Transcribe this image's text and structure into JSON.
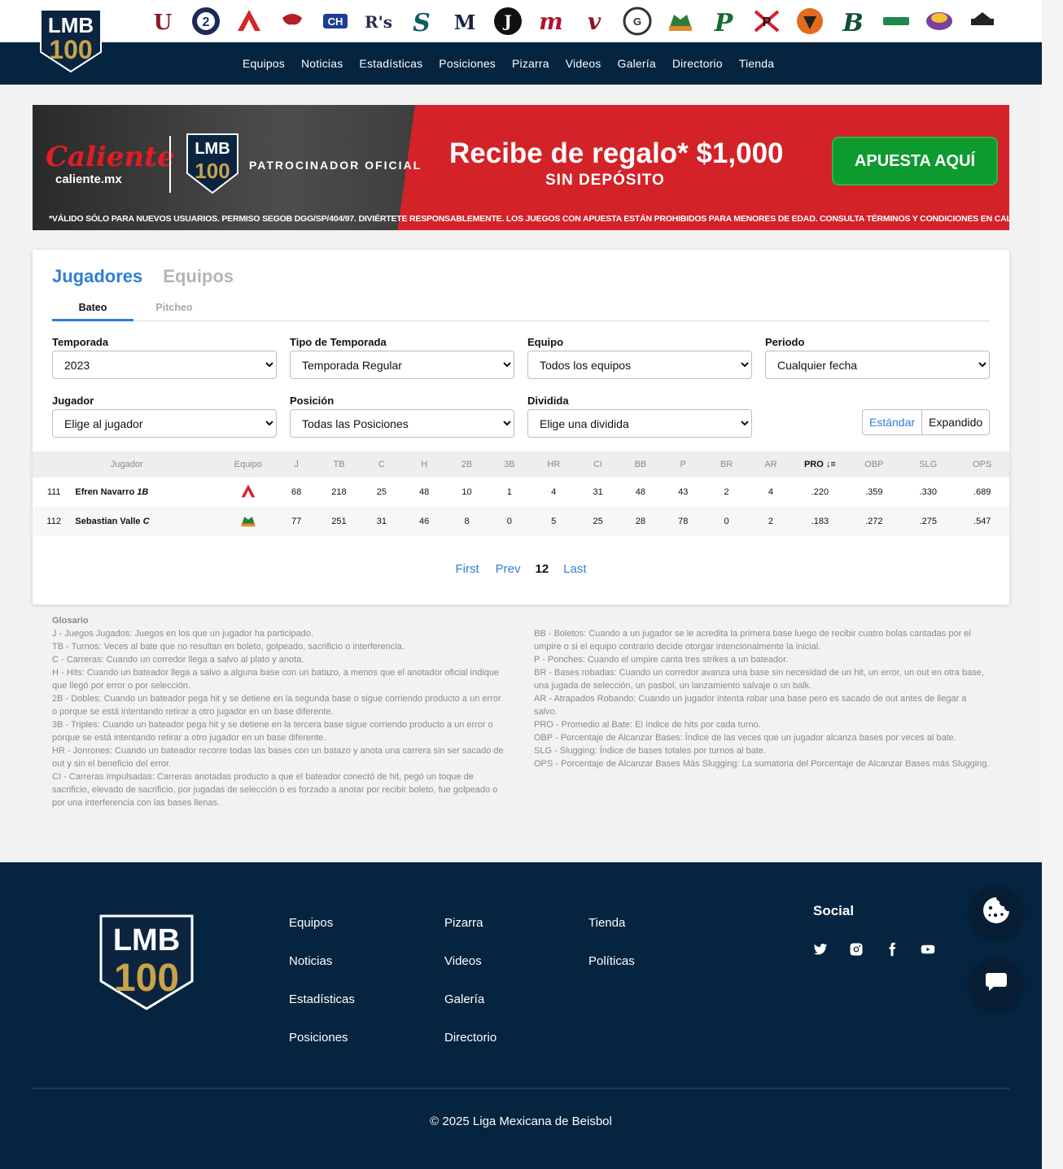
{
  "header": {
    "logo_alt": "LMB 100",
    "teams": [
      {
        "name": "Algodoneros de Unión Laguna",
        "icon": "ul-logo",
        "color": "#8b1a2b"
      },
      {
        "name": "Dos Laredos",
        "icon": "tecolotes-logo",
        "color": "#1d2a57"
      },
      {
        "name": "Acereros de Monclova",
        "icon": "acereros-logo",
        "color": "#d5262c"
      },
      {
        "name": "Toros de Tijuana",
        "icon": "toros-logo",
        "color": "#b12028"
      },
      {
        "name": "Rieleros de Aguascalientes",
        "icon": "rieleros-logo",
        "color": "#1c3f92"
      },
      {
        "name": "Saraperos de Saltillo",
        "icon": "saraperos-logo",
        "color": "#222a4e"
      },
      {
        "name": "Sultanes de Monterrey",
        "icon": "sultanes-logo",
        "color": "#0f5b63"
      },
      {
        "name": "Diablos Rojos del México",
        "icon": "diablos-logo",
        "color": "#1b2344"
      },
      {
        "name": "Generales de Durango",
        "icon": "generales-logo",
        "color": "#111111"
      },
      {
        "name": "Mariachis de Guadalajara",
        "icon": "mariachis-logo",
        "color": "#b3112e"
      },
      {
        "name": "Olmecas de Tabasco",
        "icon": "olmecas-logo",
        "color": "#8c1020"
      },
      {
        "name": "Guerreros de Oaxaca",
        "icon": "guerreros-logo",
        "color": "#333333"
      },
      {
        "name": "Leones de Yucatán",
        "icon": "leones-logo",
        "color": "#2f7a3a"
      },
      {
        "name": "Pericos de Puebla",
        "icon": "pericos-logo",
        "color": "#146b35"
      },
      {
        "name": "Piratas de Campeche",
        "icon": "piratas-logo",
        "color": "#d81d2a"
      },
      {
        "name": "Tigres de Quintana Roo",
        "icon": "tigres-logo",
        "color": "#e36b1c"
      },
      {
        "name": "Bravos de León",
        "icon": "bravos-logo",
        "color": "#0f5132"
      },
      {
        "name": "Conspiradores de Querétaro",
        "icon": "queretaro-logo",
        "color": "#1d8a4a"
      },
      {
        "name": "El Águila de Veracruz",
        "icon": "aguila-logo",
        "color": "#7b3fa0"
      },
      {
        "name": "Caliente de Durango",
        "icon": "durango-logo",
        "color": "#222222"
      }
    ],
    "nav": [
      "Equipos",
      "Noticias",
      "Estadísticas",
      "Posiciones",
      "Pizarra",
      "Videos",
      "Galería",
      "Directorio",
      "Tienda"
    ]
  },
  "banner": {
    "brand": "Caliente",
    "site": "caliente.mx",
    "lmb_label": "LMB",
    "sponsor": "PATROCINADOR OFICIAL",
    "promo_line1": "Recibe de regalo* $1,000",
    "promo_line2": "SIN DEPÓSITO",
    "cta": "APUESTA AQUÍ",
    "legal": "*VÁLIDO SÓLO PARA NUEVOS USUARIOS. PERMISO SEGOB DGG/SP/404/97. DIVIÉRTETE RESPONSABLEMENTE. LOS JUEGOS CON APUESTA ESTÁN PROHIBIDOS PARA MENORES DE EDAD. CONSULTA TÉRMINOS Y CONDICIONES EN CALIENTE.MX"
  },
  "stats": {
    "main_tabs": [
      "Jugadores",
      "Equipos"
    ],
    "sub_tabs": [
      "Bateo",
      "Pitcheo"
    ],
    "filters": {
      "temporada": {
        "label": "Temporada",
        "value": "2023"
      },
      "tipo": {
        "label": "Tipo de Temporada",
        "value": "Temporada Regular"
      },
      "equipo": {
        "label": "Equipo",
        "value": "Todos los equipos"
      },
      "periodo": {
        "label": "Periodo",
        "value": "Cualquier fecha"
      },
      "jugador": {
        "label": "Jugador",
        "value": "Elige al jugador"
      },
      "posicion": {
        "label": "Posición",
        "value": "Todas las Posiciones"
      },
      "dividida": {
        "label": "Dividida",
        "value": "Elige una dividida"
      }
    },
    "view": {
      "standard": "Estándar",
      "expanded": "Expandido"
    },
    "columns": [
      "Jugador",
      "Equipo",
      "J",
      "TB",
      "C",
      "H",
      "2B",
      "3B",
      "HR",
      "CI",
      "BB",
      "P",
      "BR",
      "AR",
      "PRO",
      "OBP",
      "SLG",
      "OPS"
    ],
    "rows": [
      {
        "rank": "111",
        "name": "Efren Navarro",
        "pos": "1B",
        "team_icon": "acereros-logo",
        "team_color": "#d5262c",
        "values": [
          "68",
          "218",
          "25",
          "48",
          "10",
          "1",
          "4",
          "31",
          "48",
          "43",
          "2",
          "4",
          ".220",
          ".359",
          ".330",
          ".689"
        ]
      },
      {
        "rank": "112",
        "name": "Sebastian Valle",
        "pos": "C",
        "team_icon": "leones-logo",
        "team_color": "#2f7a3a",
        "values": [
          "77",
          "251",
          "31",
          "46",
          "8",
          "0",
          "5",
          "25",
          "28",
          "78",
          "0",
          "2",
          ".183",
          ".272",
          ".275",
          ".547"
        ]
      }
    ],
    "pager": {
      "first": "First",
      "prev": "Prev",
      "current": "12",
      "last": "Last"
    }
  },
  "glossary": {
    "title": "Glosario",
    "left": [
      "J - Juegos Jugados: Juegos en los que un jugador ha participado.",
      "TB - Turnos: Veces al bate que no resultan en boleto, golpeado, sacrificio o interferencia.",
      "C - Carreras: Cuando un corredor llega a salvo al plato y anota.",
      "H - Hits: Cuando un bateador llega a salvo a alguna base con un batazo, a menos que el anotador oficial indique que llegó por error o por selección.",
      "2B - Dobles: Cuando un bateador pega hit y se detiene en la segunda base o sigue corriendo producto a un error o porque se está intentando retirar a otro jugador en un base diferente.",
      "3B - Triples: Cuando un bateador pega hit y se detiene en la tercera base sigue corriendo producto a un error o porque se está intentando retirar a otro jugador en un base diferente.",
      "HR - Jonrones: Cuando un bateador recorre todas las bases con un batazo y anota una carrera sin ser sacado de out y sin el beneficio del error.",
      "CI - Carreras Impulsadas: Carreras anotadas producto a que el bateador conectó de hit, pegó un toque de sacrificio, elevado de sacrificio, por jugadas de selección o es forzado a anotar por recibir boleto, fue golpeado o por una interferencia con las bases llenas."
    ],
    "right": [
      "BB - Boletos: Cuando a un jugador se le acredita la primera base luego de recibir cuatro bolas cantadas por el umpire o si el equipo contrario decide otorgar intencionalmente la inicial.",
      "P - Ponches: Cuando el umpire canta tres strikes a un bateador.",
      "BR - Bases robadas: Cuando un corredor avanza una base sin necesidad de un hit, un error, un out en otra base, una jugada de selección, un pasbol, un lanzamiento salvaje o un balk.",
      "AR - Atrapados Robando: Cuando un jugador intenta robar una base pero es sacado de out antes de llegar a salvo.",
      "PRO - Promedio al Bate: El índice de hits por cada turno.",
      "OBP - Porcentaje de Alcanzar Bases: Índice de las veces que un jugador alcanza bases por veces al bate.",
      "SLG - Slugging: Índice de bases totales por turnos al bate.",
      "OPS - Porcentaje de Alcanzar Bases Más Slugging: La sumatoria del Porcentaje de Alcanzar Bases más Slugging."
    ]
  },
  "footer": {
    "col1": [
      "Equipos",
      "Noticias",
      "Estadísticas",
      "Posiciones"
    ],
    "col2": [
      "Pizarra",
      "Videos",
      "Galería",
      "Directorio"
    ],
    "col3": [
      "Tienda",
      "Políticas"
    ],
    "social_title": "Social",
    "social": [
      "twitter-icon",
      "instagram-icon",
      "facebook-icon",
      "youtube-icon"
    ],
    "copyright": "© 2025 Liga Mexicana de Beisbol"
  }
}
